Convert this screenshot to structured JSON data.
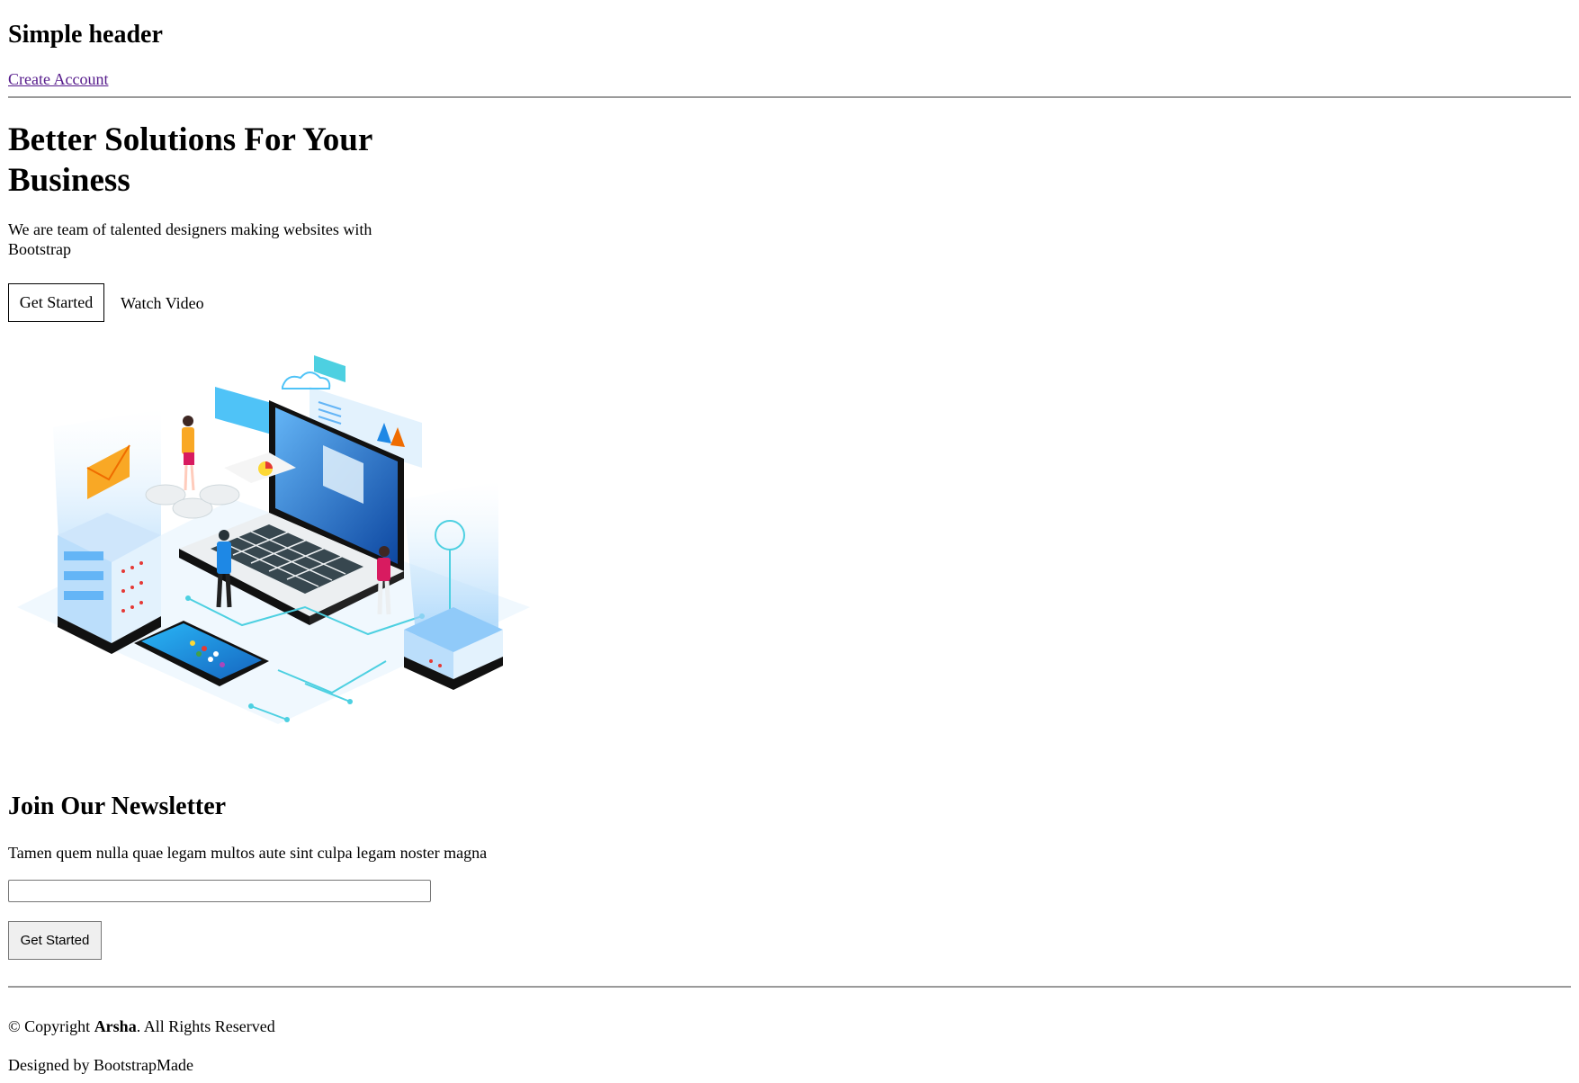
{
  "header": {
    "title": "Simple header",
    "create_account_label": "Create Account"
  },
  "hero": {
    "title": "Better Solutions For Your Business",
    "description": "We are team of talented designers making websites with Bootstrap",
    "primary_button_label": "Get Started",
    "secondary_button_label": "Watch Video",
    "illustration_icon": "hero-illustration-icon"
  },
  "newsletter": {
    "title": "Join Our Newsletter",
    "description": "Tamen quem nulla quae legam multos aute sint culpa legam noster magna",
    "email_value": "",
    "submit_label": "Get Started"
  },
  "footer": {
    "copyright_prefix": "© Copyright ",
    "brand": "Arsha",
    "copyright_suffix": ". All Rights Reserved",
    "designed_by": "Designed by BootstrapMade"
  },
  "colors": {
    "link_visited": "#551a8b",
    "accent_blue": "#1e88e5",
    "accent_cyan": "#4dd0e1",
    "divider": "#9a9a9a"
  }
}
